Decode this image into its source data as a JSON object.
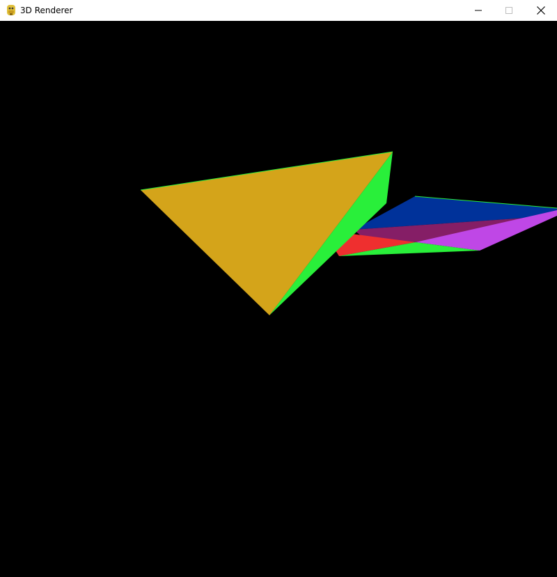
{
  "window": {
    "title": "3D Renderer",
    "app_icon": "python-snake-icon"
  },
  "controls": {
    "minimize_icon": "minimize-icon",
    "maximize_icon": "maximize-icon",
    "close_icon": "close-icon"
  },
  "scene": {
    "background": "#000000",
    "face_colors": {
      "front_face": "#d4a41a",
      "front_side": "#29ef3a",
      "back_blue": "#00329a",
      "back_purple": "#851e66",
      "back_magenta": "#bf47e6",
      "back_red": "#ef2f2f",
      "back_green": "#29ef3a"
    }
  }
}
